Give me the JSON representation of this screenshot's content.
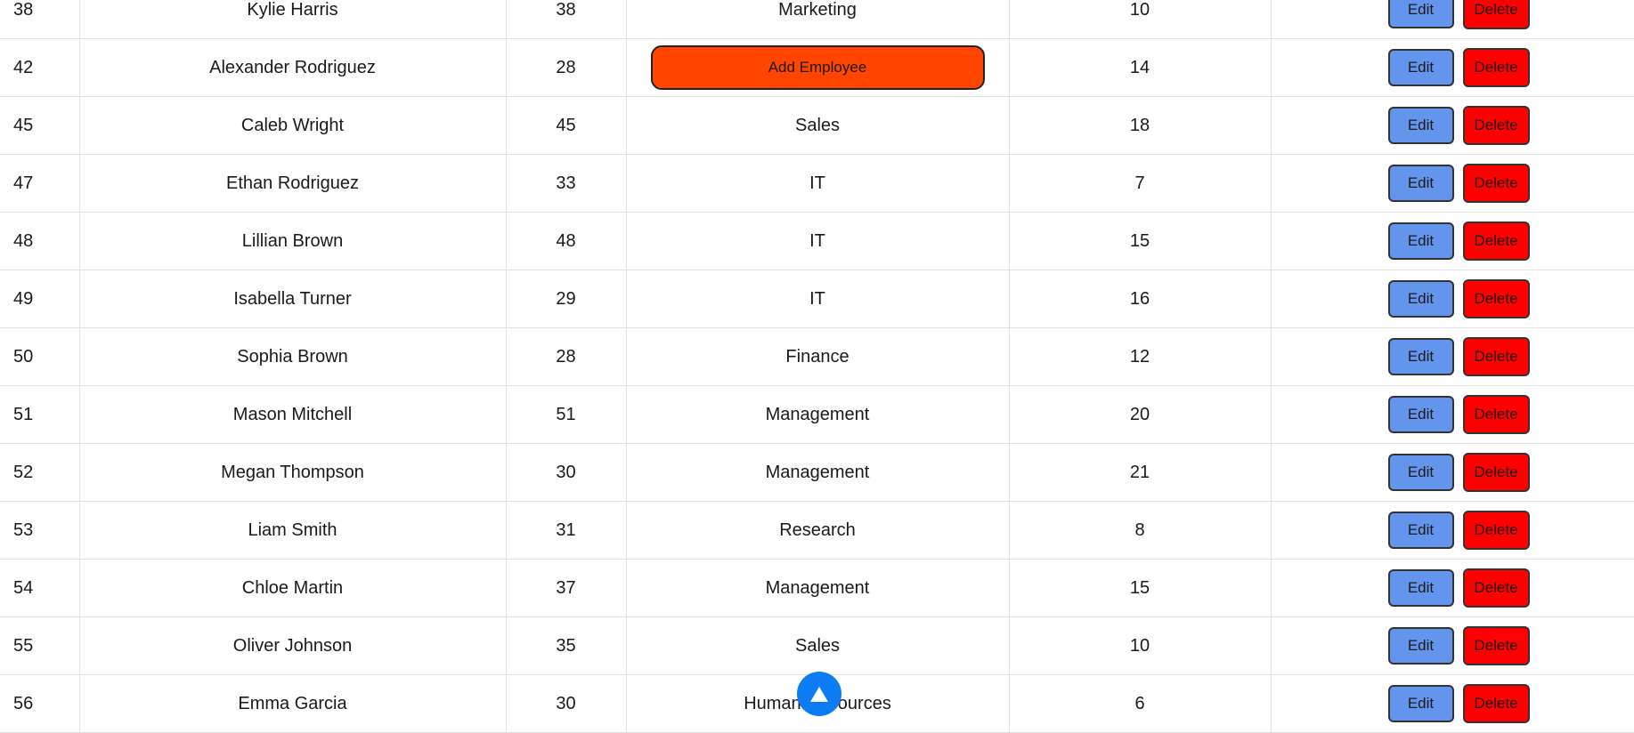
{
  "table": {
    "rows": [
      {
        "id": "38",
        "name": "Kylie Harris",
        "age": "38",
        "department": "Marketing",
        "experience": "10"
      },
      {
        "id": "42",
        "name": "Alexander Rodriguez",
        "age": "28",
        "department": "",
        "experience": "14"
      },
      {
        "id": "45",
        "name": "Caleb Wright",
        "age": "45",
        "department": "Sales",
        "experience": "18"
      },
      {
        "id": "47",
        "name": "Ethan Rodriguez",
        "age": "33",
        "department": "IT",
        "experience": "7"
      },
      {
        "id": "48",
        "name": "Lillian Brown",
        "age": "48",
        "department": "IT",
        "experience": "15"
      },
      {
        "id": "49",
        "name": "Isabella Turner",
        "age": "29",
        "department": "IT",
        "experience": "16"
      },
      {
        "id": "50",
        "name": "Sophia Brown",
        "age": "28",
        "department": "Finance",
        "experience": "12"
      },
      {
        "id": "51",
        "name": "Mason Mitchell",
        "age": "51",
        "department": "Management",
        "experience": "20"
      },
      {
        "id": "52",
        "name": "Megan Thompson",
        "age": "30",
        "department": "Management",
        "experience": "21"
      },
      {
        "id": "53",
        "name": "Liam Smith",
        "age": "31",
        "department": "Research",
        "experience": "8"
      },
      {
        "id": "54",
        "name": "Chloe Martin",
        "age": "37",
        "department": "Management",
        "experience": "15"
      },
      {
        "id": "55",
        "name": "Oliver Johnson",
        "age": "35",
        "department": "Sales",
        "experience": "10"
      },
      {
        "id": "56",
        "name": "Emma Garcia",
        "age": "30",
        "department": "Human Resources",
        "experience": "6"
      }
    ],
    "edit_label": "Edit",
    "delete_label": "Delete"
  },
  "add_employee_label": "Add Employee",
  "scroll_top": {
    "icon": "arrow-up-icon"
  },
  "colors": {
    "edit_button": "#6495ed",
    "delete_button": "#ff0000",
    "add_button": "#ff4500",
    "scroll_top_button": "#0d7cf2"
  }
}
